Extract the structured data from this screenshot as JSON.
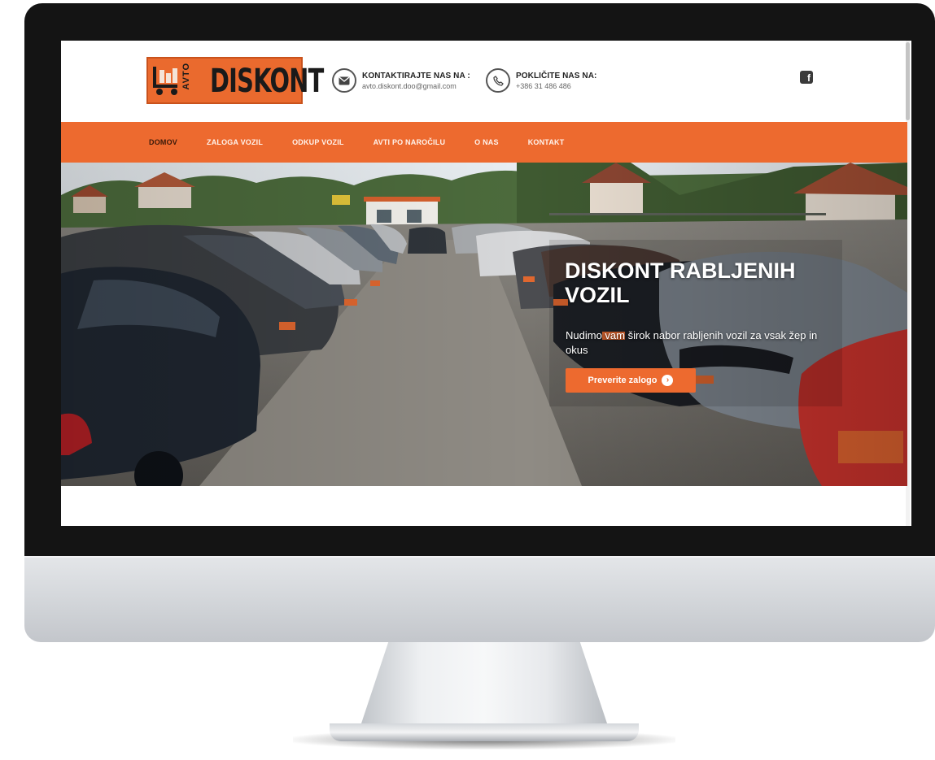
{
  "header": {
    "logo": {
      "small_text": "AVTO",
      "big_text": "DISKONT"
    },
    "email_contact": {
      "icon": "envelope-icon",
      "label": "KONTAKTIRAJTE NAS NA :",
      "value": "avto.diskont.doo@gmail.com"
    },
    "phone_contact": {
      "icon": "phone-icon",
      "label": "POKLIČITE NAS NA:",
      "value": "+386 31 486 486"
    },
    "social": {
      "icon": "facebook-icon",
      "glyph": "f"
    }
  },
  "nav": {
    "items": [
      {
        "label": "DOMOV",
        "active": true
      },
      {
        "label": "ZALOGA VOZIL",
        "active": false
      },
      {
        "label": "ODKUP VOZIL",
        "active": false
      },
      {
        "label": "AVTI PO NAROČILU",
        "active": false
      },
      {
        "label": "O NAS",
        "active": false
      },
      {
        "label": "KONTAKT",
        "active": false
      }
    ]
  },
  "hero": {
    "title": "DISKONT RABLJENIH VOZIL",
    "subtitle": "Nudimo vam širok nabor rabljenih vozil za vsak žep in okus",
    "cta_label": "Preverite zalogo",
    "cta_icon": "arrow-right-circle-icon",
    "cta_glyph": "›"
  },
  "colors": {
    "accent": "#ed6a2f",
    "bezel": "#141414",
    "chin": "#d2d5d9"
  }
}
